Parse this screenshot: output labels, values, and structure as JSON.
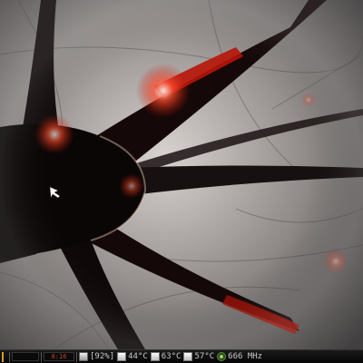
{
  "taskbar": {
    "clock_text": "8:16",
    "memory_percent": "92%",
    "sensors": [
      {
        "value": "44°C"
      },
      {
        "value": "63°C"
      },
      {
        "value": "57°C"
      }
    ],
    "cpu_freq": "666 MHz"
  },
  "colors": {
    "panel_bg": "#0a0a0a",
    "text": "#c8c8c8",
    "workspace_accent": "#d8a020",
    "neuron_glow": "#e02010"
  },
  "icons": {
    "memory": "memory-chip-icon",
    "temperature": "thermometer-icon",
    "cpu": "cpu-icon",
    "cursor": "mouse-cursor-icon"
  }
}
